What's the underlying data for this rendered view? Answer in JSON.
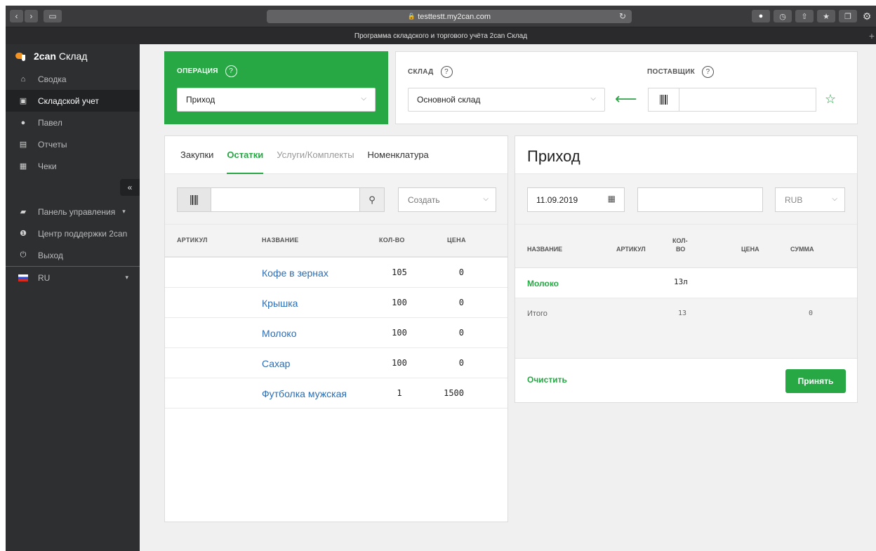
{
  "browser": {
    "url": "testtestt.my2can.com",
    "tab_title": "Программа складского и торгового учёта 2can Склад"
  },
  "sidebar": {
    "brand_bold": "2can",
    "brand_rest": "Склад",
    "items": [
      {
        "label": "Сводка",
        "icon": "home-icon"
      },
      {
        "label": "Складской учет",
        "icon": "warehouse-icon"
      },
      {
        "label": "Павел",
        "icon": "user-icon"
      },
      {
        "label": "Отчеты",
        "icon": "reports-icon"
      },
      {
        "label": "Чеки",
        "icon": "receipt-icon"
      }
    ],
    "collapse_label": "«",
    "bottom_items": [
      {
        "label": "Панель управления",
        "icon": "briefcase-icon"
      },
      {
        "label": "Центр поддержки 2can",
        "icon": "info-icon"
      },
      {
        "label": "Выход",
        "icon": "power-icon"
      }
    ],
    "language": "RU"
  },
  "operation": {
    "label": "ОПЕРАЦИЯ",
    "value": "Приход"
  },
  "warehouse": {
    "label": "СКЛАД",
    "value": "Основной склад"
  },
  "supplier": {
    "label": "ПОСТАВЩИК",
    "value": ""
  },
  "left": {
    "tabs": [
      "Закупки",
      "Остатки",
      "Услуги/Комплекты",
      "Номенклатура"
    ],
    "create_label": "Создать",
    "columns": [
      "АРТИКУЛ",
      "НАЗВАНИЕ",
      "КОЛ-ВО",
      "ЦЕНА"
    ],
    "rows": [
      {
        "name": "Кофе в зернах",
        "qty": "105",
        "price": "0"
      },
      {
        "name": "Крышка",
        "qty": "100",
        "price": "0"
      },
      {
        "name": "Молоко",
        "qty": "100",
        "price": "0"
      },
      {
        "name": "Сахар",
        "qty": "100",
        "price": "0"
      },
      {
        "name": "Футболка мужская",
        "qty": "1",
        "price": "1500"
      }
    ]
  },
  "right": {
    "title": "Приход",
    "date": "11.09.2019",
    "currency": "RUB",
    "columns": {
      "name": "НАЗВАНИЕ",
      "sku": "АРТИКУЛ",
      "qty_1": "КОЛ-",
      "qty_2": "ВО",
      "price": "ЦЕНА",
      "sum": "СУММА"
    },
    "rows": [
      {
        "name": "Молоко",
        "qty": "13л"
      }
    ],
    "total_label": "Итого",
    "total_qty": "13",
    "total_sum": "0",
    "clear_label": "Очистить",
    "accept_label": "Принять"
  }
}
